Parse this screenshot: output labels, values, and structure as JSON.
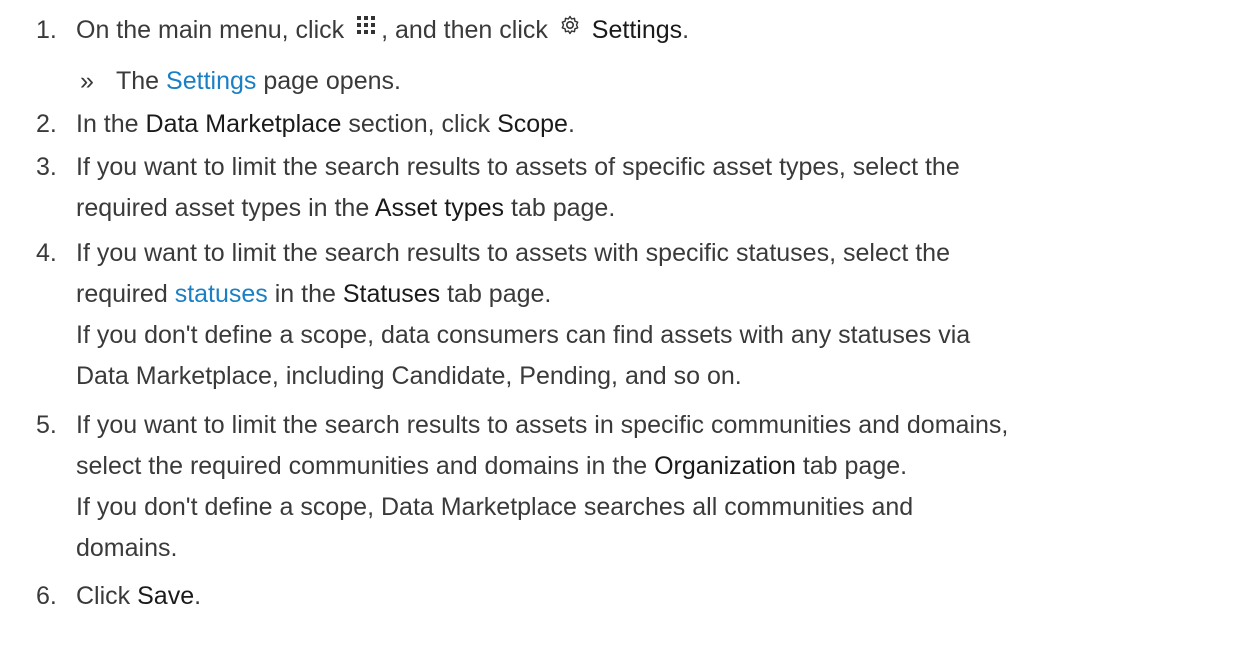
{
  "steps": [
    {
      "num": "1.",
      "a": "On the main menu, click",
      "b": ", and then click",
      "c": "Settings",
      "d": ".",
      "result_prefix": "The",
      "result_link": "Settings",
      "result_suffix": "page opens."
    },
    {
      "num": "2.",
      "a": "In the",
      "b": "Data Marketplace",
      "c": "section, click",
      "d": "Scope",
      "e": "."
    },
    {
      "num": "3.",
      "l1": "If you want to limit the search results to assets of specific asset types, select the",
      "l2a": "required asset types in the",
      "l2b": "Asset types",
      "l2c": "tab page."
    },
    {
      "num": "4.",
      "l1": "If you want to limit the search results to assets with specific statuses, select the",
      "l2a": "required",
      "l2b": "statuses",
      "l2c": "in the",
      "l2d": "Statuses",
      "l2e": "tab page.",
      "l3": "If you don't define a scope, data consumers can find assets with any statuses via",
      "l4": "Data Marketplace, including Candidate, Pending, and so on."
    },
    {
      "num": "5.",
      "l1": "If you want to limit the search results to assets in specific communities and domains,",
      "l2a": "select the required communities and domains in the",
      "l2b": "Organization",
      "l2c": "tab page.",
      "l3": "If you don't define a scope, Data Marketplace searches all communities and",
      "l4": "domains."
    },
    {
      "num": "6.",
      "a": "Click",
      "b": "Save",
      "c": "."
    }
  ],
  "result_chevron": "»",
  "icons": {
    "menu": "main-menu-grid-icon",
    "settings": "gear-icon"
  }
}
